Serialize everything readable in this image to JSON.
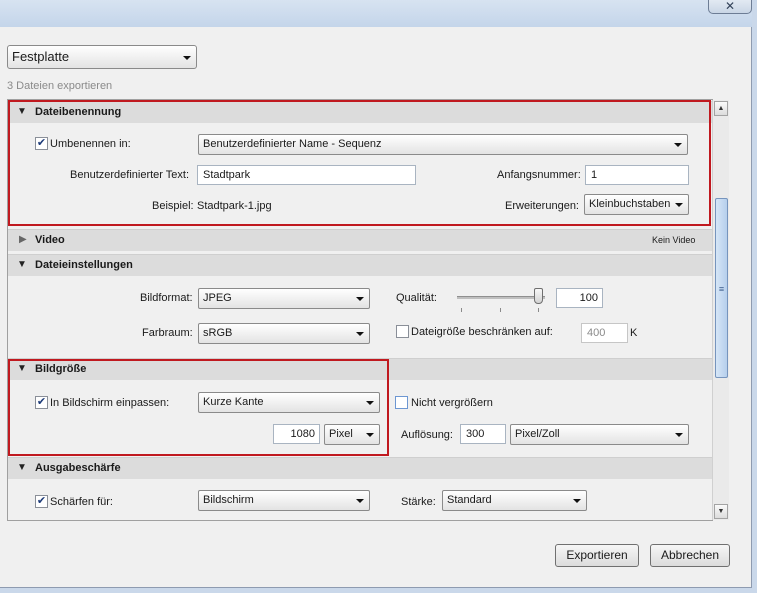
{
  "window": {
    "close_label": "✕"
  },
  "destination": {
    "selected": "Festplatte"
  },
  "file_count_text": "3 Dateien exportieren",
  "sections": {
    "file_naming": {
      "title": "Dateibenennung",
      "rename_label": "Umbenennen in:",
      "rename_checked": true,
      "rename_template": "Benutzerdefinierter Name - Sequenz",
      "custom_text_label": "Benutzerdefinierter Text:",
      "custom_text_value": "Stadtpark",
      "start_number_label": "Anfangsnummer:",
      "start_number_value": "1",
      "example_label": "Beispiel:",
      "example_value": "Stadtpark-1.jpg",
      "extensions_label": "Erweiterungen:",
      "extensions_value": "Kleinbuchstaben"
    },
    "video": {
      "title": "Video",
      "status": "Kein Video"
    },
    "file_settings": {
      "title": "Dateieinstellungen",
      "format_label": "Bildformat:",
      "format_value": "JPEG",
      "quality_label": "Qualität:",
      "quality_value": "100",
      "colorspace_label": "Farbraum:",
      "colorspace_value": "sRGB",
      "limit_size_label": "Dateigröße beschränken auf:",
      "limit_size_checked": false,
      "limit_size_value": "400",
      "limit_size_unit": "K"
    },
    "image_sizing": {
      "title": "Bildgröße",
      "fit_label": "In Bildschirm einpassen:",
      "fit_checked": true,
      "fit_mode": "Kurze Kante",
      "no_enlarge_label": "Nicht vergrößern",
      "no_enlarge_checked": false,
      "size_value": "1080",
      "size_unit": "Pixel",
      "resolution_label": "Auflösung:",
      "resolution_value": "300",
      "resolution_unit": "Pixel/Zoll"
    },
    "output_sharpening": {
      "title": "Ausgabeschärfe",
      "sharpen_label": "Schärfen für:",
      "sharpen_checked": true,
      "sharpen_for": "Bildschirm",
      "amount_label": "Stärke:",
      "amount_value": "Standard"
    }
  },
  "buttons": {
    "export": "Exportieren",
    "cancel": "Abbrechen"
  },
  "colors": {
    "highlight": "#c0191f",
    "section_bar": "#dcdcdc",
    "dialog_bg": "#f0f0f0"
  }
}
